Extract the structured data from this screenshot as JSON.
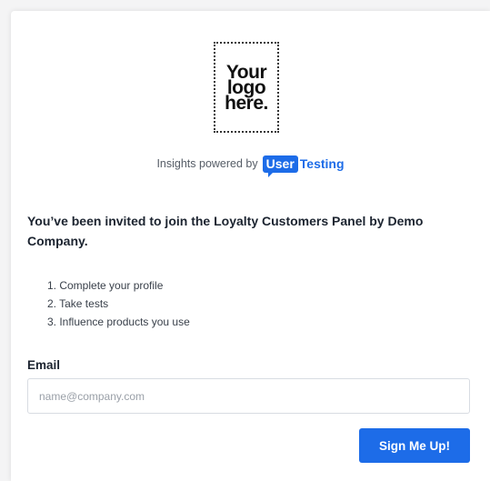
{
  "logo": {
    "line1": "Your",
    "line2": "logo",
    "line3": "here."
  },
  "powered": {
    "text": "Insights powered by",
    "brand_part1": "User",
    "brand_part2": "Testing"
  },
  "invite": {
    "headline": "You’ve been invited to join the Loyalty Customers Panel by Demo Company."
  },
  "steps": [
    "1. Complete your profile",
    "2. Take tests",
    "3. Influence products you use"
  ],
  "form": {
    "email_label": "Email",
    "email_placeholder": "name@company.com",
    "email_value": "",
    "submit_label": "Sign Me Up!"
  },
  "colors": {
    "accent": "#1d6ce8",
    "text_dark": "#1c2430",
    "text_muted": "#555c66",
    "border": "#d8dce2"
  }
}
